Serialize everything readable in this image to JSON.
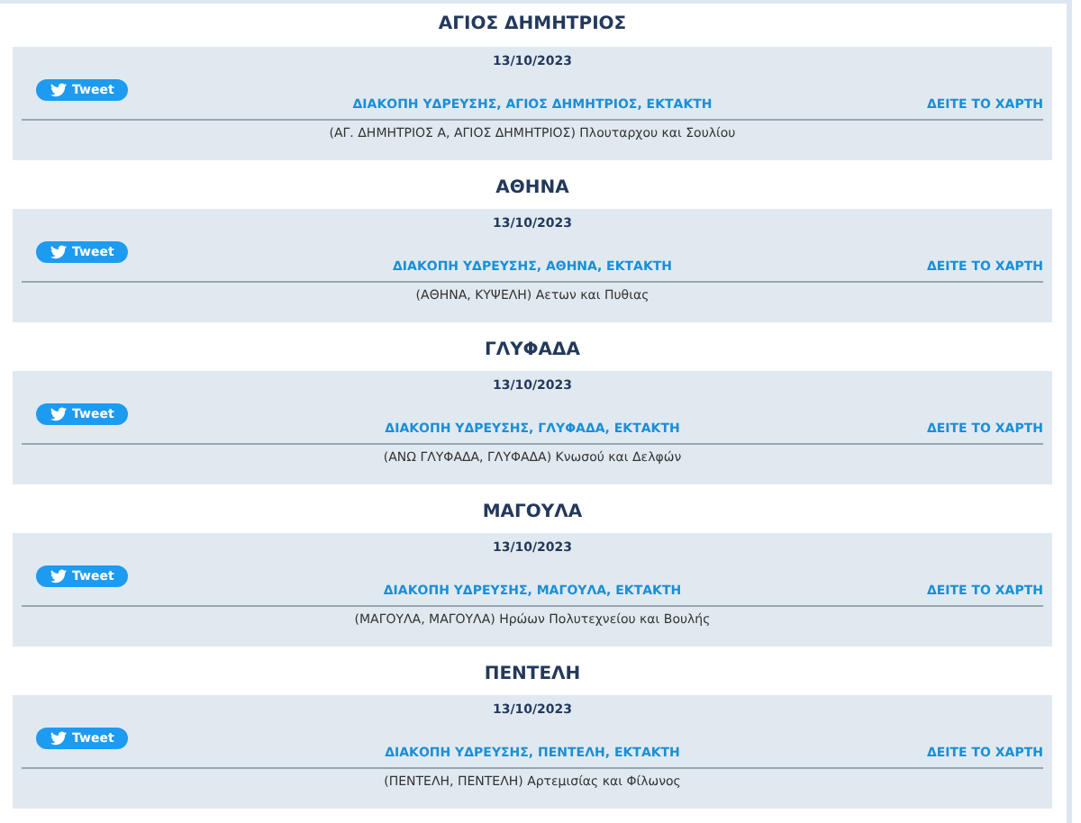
{
  "sections": [
    {
      "heading": "ΑΓΙΟΣ ΔΗΜΗΤΡΙΟΣ",
      "date": "13/10/2023",
      "tweet": "Tweet",
      "title": "ΔΙΑΚΟΠΗ ΥΔΡΕΥΣΗΣ, ΑΓΙΟΣ ΔΗΜΗΤΡΙΟΣ, ΕΚΤΑΚΤΗ",
      "map_link": "ΔΕΙΤΕ ΤΟ ΧΑΡΤΗ",
      "address": "(ΑΓ. ΔΗΜΗΤΡΙΟΣ Α, ΑΓΙΟΣ ΔΗΜΗΤΡΙΟΣ) Πλουταρχου και Σουλίου"
    },
    {
      "heading": "ΑΘΗΝΑ",
      "date": "13/10/2023",
      "tweet": "Tweet",
      "title": "ΔΙΑΚΟΠΗ ΥΔΡΕΥΣΗΣ, ΑΘΗΝΑ, ΕΚΤΑΚΤΗ",
      "map_link": "ΔΕΙΤΕ ΤΟ ΧΑΡΤΗ",
      "address": "(ΑΘΗΝΑ, ΚΥΨΕΛΗ) Αετων και Πυθιας"
    },
    {
      "heading": "ΓΛΥΦΑΔΑ",
      "date": "13/10/2023",
      "tweet": "Tweet",
      "title": "ΔΙΑΚΟΠΗ ΥΔΡΕΥΣΗΣ, ΓΛΥΦΑΔΑ, ΕΚΤΑΚΤΗ",
      "map_link": "ΔΕΙΤΕ ΤΟ ΧΑΡΤΗ",
      "address": "(ΑΝΩ ΓΛΥΦΑΔΑ, ΓΛΥΦΑΔΑ) Κνωσού και Δελφών"
    },
    {
      "heading": "ΜΑΓΟΥΛΑ",
      "date": "13/10/2023",
      "tweet": "Tweet",
      "title": "ΔΙΑΚΟΠΗ ΥΔΡΕΥΣΗΣ, ΜΑΓΟΥΛΑ, ΕΚΤΑΚΤΗ",
      "map_link": "ΔΕΙΤΕ ΤΟ ΧΑΡΤΗ",
      "address": "(ΜΑΓΟΥΛΑ, ΜΑΓΟΥΛΑ) Ηρώων Πολυτεχνείου και Βουλής"
    },
    {
      "heading": "ΠΕΝΤΕΛΗ",
      "date": "13/10/2023",
      "tweet": "Tweet",
      "title": "ΔΙΑΚΟΠΗ ΥΔΡΕΥΣΗΣ, ΠΕΝΤΕΛΗ, ΕΚΤΑΚΤΗ",
      "map_link": "ΔΕΙΤΕ ΤΟ ΧΑΡΤΗ",
      "address": "(ΠΕΝΤΕΛΗ, ΠΕΝΤΕΛΗ) Αρτεμισίας και Φίλωνος"
    }
  ]
}
